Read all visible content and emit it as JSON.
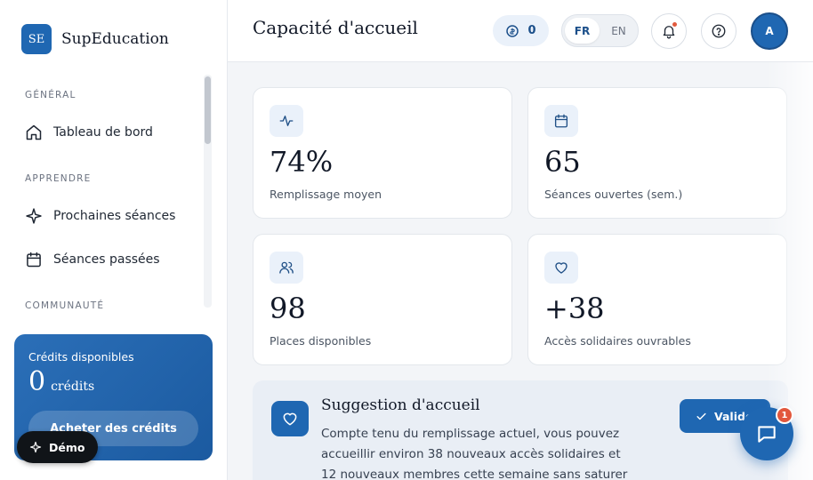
{
  "brand": {
    "logo_text": "SE",
    "name": "SupEducation"
  },
  "sidebar": {
    "sections": [
      "GÉNÉRAL",
      "APPRENDRE",
      "COMMUNAUTÉ"
    ],
    "items": [
      {
        "label": "Tableau de bord",
        "icon": "home-icon"
      },
      {
        "label": "Prochaines séances",
        "icon": "sparkle-icon"
      },
      {
        "label": "Séances passées",
        "icon": "calendar-icon"
      }
    ]
  },
  "credits": {
    "title": "Crédits disponibles",
    "value": "0",
    "unit": "crédits",
    "buy_label": "Acheter des crédits"
  },
  "demo": {
    "label": "Démo"
  },
  "header": {
    "title": "Capacité d'accueil",
    "coin_count": "0",
    "lang": {
      "fr": "FR",
      "en": "EN",
      "selected": "FR"
    },
    "avatar_initial": "A"
  },
  "stats": [
    {
      "value": "74%",
      "label": "Remplissage moyen",
      "icon": "activity-icon"
    },
    {
      "value": "65",
      "label": "Séances ouvertes (sem.)",
      "icon": "calendar-icon"
    },
    {
      "value": "98",
      "label": "Places disponibles",
      "icon": "users-icon"
    },
    {
      "value": "+38",
      "label": "Accès solidaires ouvrables",
      "icon": "heart-icon"
    }
  ],
  "suggestion": {
    "title": "Suggestion d'accueil",
    "text": "Compte tenu du remplissage actuel, vous pouvez accueillir environ 38 nouveaux accès solidaires et 12 nouveaux membres cette semaine sans saturer",
    "button_label": "Valider"
  },
  "chat": {
    "badge": "1"
  },
  "colors": {
    "primary": "#1f67b2",
    "badge": "#e2573d"
  }
}
